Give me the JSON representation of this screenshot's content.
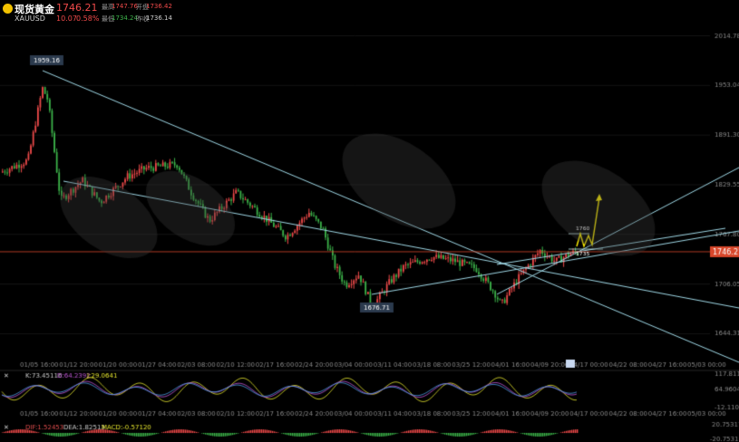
{
  "header": {
    "symbol_name": "现货黄金",
    "symbol_code": "XAUUSD",
    "price": "1746.21",
    "change": "10.07",
    "change_pct": "0.58%",
    "high_label": "最高",
    "high": "1747.76",
    "open_label": "开盘",
    "open": "1736.42",
    "low_label": "最低",
    "low": "1734.24",
    "prev_label": "昨收",
    "prev": "1736.14"
  },
  "colors": {
    "up": "#f04a4a",
    "down": "#3cb44a",
    "trend": "#9fd8e6",
    "price_line": "#d9472b",
    "target": "#fff000"
  },
  "chart_data": {
    "type": "candlestick",
    "y_axis_ticks": [
      "2014.78",
      "1953.04",
      "1891.30",
      "1829.55",
      "1767.80",
      "1706.05",
      "1644.31"
    ],
    "ylim": [
      1620,
      2030
    ],
    "current_price_tag": "1746.21",
    "x_ticks": [
      "01/05 16:00",
      "01/12 20:00",
      "01/20 00:00",
      "01/27 04:00",
      "02/03 08:00",
      "02/10 12:00",
      "02/17 16:00",
      "02/24 20:00",
      "03/04 00:00",
      "03/11 04:00",
      "03/18 08:00",
      "03/25 12:00",
      "04/01 16:00",
      "04/09 20:00",
      "04/17 00:00",
      "04/22 08:00",
      "04/27 16:00",
      "05/03 00:00"
    ],
    "annotations": {
      "high_point": "1959.16",
      "low_point": "1676.71",
      "level_upper": "1760",
      "level_lower": "1735"
    },
    "kdj": {
      "label_k": "K:73.45116",
      "label_d": "D:64.2392",
      "label_j": "J:29.0641",
      "axis": [
        "117.811",
        "64.9604",
        "-12.1102"
      ]
    },
    "macd": {
      "label_dif": "DIF:1.52453",
      "label_dea": "DEA:1.82513",
      "label_macd": "MACD:-0.57120",
      "axis": [
        "20.75317",
        "-20.75317"
      ]
    }
  }
}
